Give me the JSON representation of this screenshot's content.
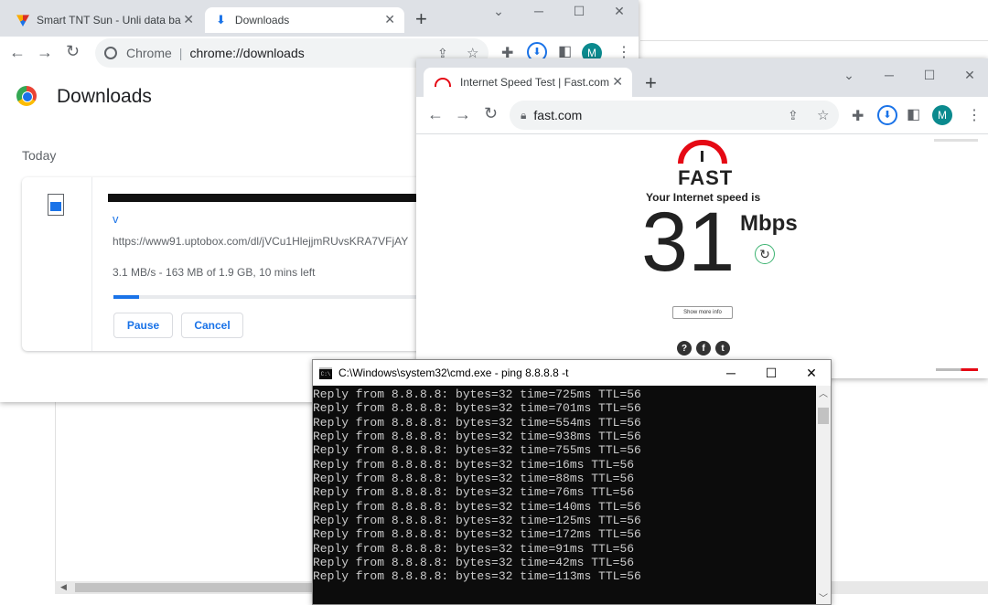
{
  "bg_window": {
    "scroll_left_arrow": "◀"
  },
  "downloads_window": {
    "tabs": [
      {
        "label": "Smart TNT Sun - Unli data bali"
      },
      {
        "label": "Downloads"
      }
    ],
    "new_tab": "+",
    "address": {
      "site": "Chrome",
      "separator": "|",
      "url": "chrome://downloads"
    },
    "profile_initial": "M",
    "page_title": "Downloads",
    "section_label": "Today",
    "item": {
      "filename_tail": "v",
      "source_url": "https://www91.uptobox.com/dl/jVCu1HlejjmRUvsKRA7VFjAY",
      "status": "3.1 MB/s - 163 MB of 1.9 GB, 10 mins left",
      "progress_percent": 8.4,
      "pause_label": "Pause",
      "cancel_label": "Cancel"
    }
  },
  "fast_window": {
    "tab_title": "Internet Speed Test | Fast.com",
    "new_tab": "+",
    "url": "fast.com",
    "profile_initial": "M",
    "logo_text": "FAST",
    "heading": "Your Internet speed is",
    "speed_value": "31",
    "speed_unit": "Mbps",
    "more_info_label": "Show more info",
    "social_icons": [
      "?",
      "f",
      "t"
    ],
    "reload_icon": "↻"
  },
  "cmd_window": {
    "title": "C:\\Windows\\system32\\cmd.exe - ping  8.8.8.8 -t",
    "icon_label": "C:\\",
    "lines": [
      "Reply from 8.8.8.8: bytes=32 time=725ms TTL=56",
      "Reply from 8.8.8.8: bytes=32 time=701ms TTL=56",
      "Reply from 8.8.8.8: bytes=32 time=554ms TTL=56",
      "Reply from 8.8.8.8: bytes=32 time=938ms TTL=56",
      "Reply from 8.8.8.8: bytes=32 time=755ms TTL=56",
      "Reply from 8.8.8.8: bytes=32 time=16ms TTL=56",
      "Reply from 8.8.8.8: bytes=32 time=88ms TTL=56",
      "Reply from 8.8.8.8: bytes=32 time=76ms TTL=56",
      "Reply from 8.8.8.8: bytes=32 time=140ms TTL=56",
      "Reply from 8.8.8.8: bytes=32 time=125ms TTL=56",
      "Reply from 8.8.8.8: bytes=32 time=172ms TTL=56",
      "Reply from 8.8.8.8: bytes=32 time=91ms TTL=56",
      "Reply from 8.8.8.8: bytes=32 time=42ms TTL=56",
      "Reply from 8.8.8.8: bytes=32 time=113ms TTL=56"
    ],
    "colors": {
      "background": "#0c0c0c",
      "text": "#cccccc"
    }
  },
  "colors": {
    "chrome_tabstrip": "#dee1e6",
    "link_blue": "#1a73e8",
    "fast_red": "#e50914",
    "fast_green": "#3cb371"
  }
}
